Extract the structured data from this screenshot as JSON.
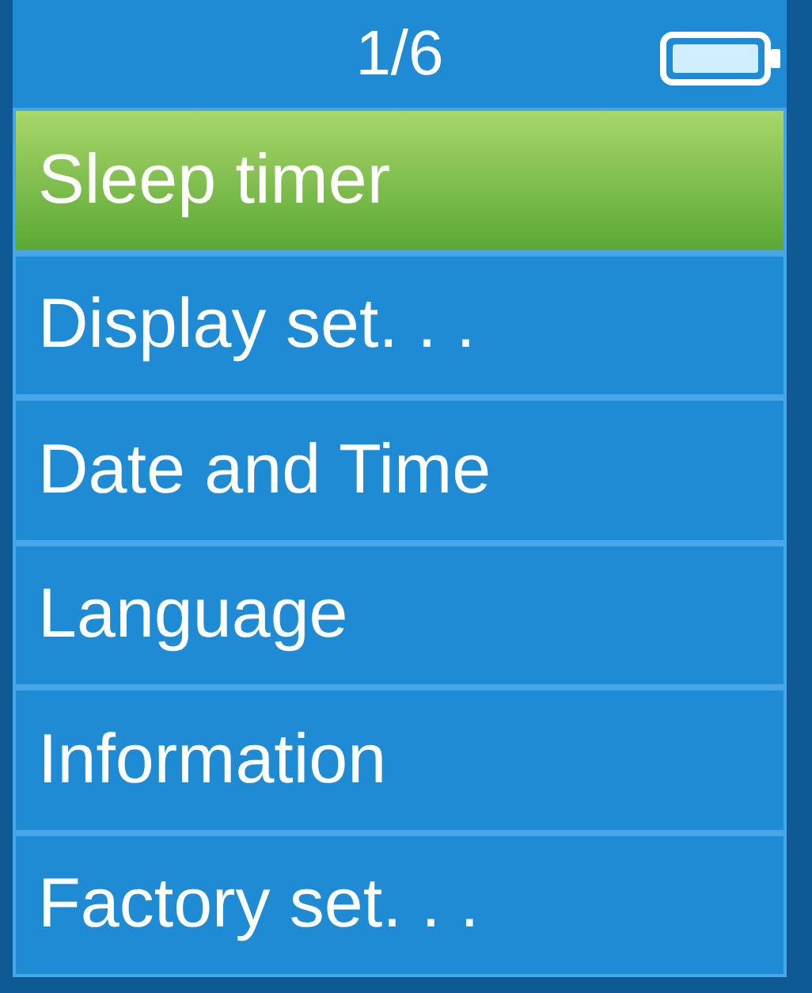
{
  "header": {
    "page": "1/6"
  },
  "menu": [
    {
      "label": "Sleep timer",
      "selected": true
    },
    {
      "label": "Display set. . .",
      "selected": false
    },
    {
      "label": "Date and Time",
      "selected": false
    },
    {
      "label": "Language",
      "selected": false
    },
    {
      "label": "Information",
      "selected": false
    },
    {
      "label": "Factory set. . .",
      "selected": false
    }
  ]
}
